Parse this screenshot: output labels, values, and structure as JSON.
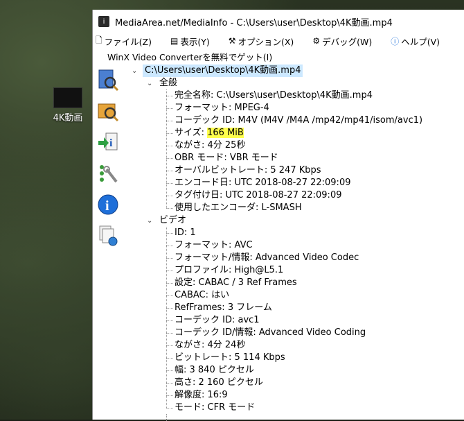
{
  "desktop": {
    "icon_label": "4K動画"
  },
  "window": {
    "title": "MediaArea.net/MediaInfo - C:\\Users\\user\\Desktop\\4K動画.mp4"
  },
  "menu": [
    {
      "label": "ファイル(Z)",
      "icon": "file-icon"
    },
    {
      "label": "表示(Y)",
      "icon": "view-icon"
    },
    {
      "label": "オプション(X)",
      "icon": "options-icon"
    },
    {
      "label": "デバッグ(W)",
      "icon": "debug-icon"
    },
    {
      "label": "ヘルプ(V)",
      "icon": "help-icon"
    }
  ],
  "menu2": {
    "label": "WinX Video Converterを無料でゲット(I)"
  },
  "tree": {
    "root": "C:\\Users\\user\\Desktop\\4K動画.mp4",
    "general": {
      "label": "全般",
      "items": [
        "完全名称: C:\\Users\\user\\Desktop\\4K動画.mp4",
        "フォーマット: MPEG-4",
        "コーデック ID: M4V  (M4V /M4A /mp42/mp41/isom/avc1)"
      ],
      "size_label": "サイズ: ",
      "size_value": "166 MiB",
      "items2": [
        "ながさ: 4分 25秒",
        "OBR モード: VBR モード",
        "オーバルビットレート: 5 247 Kbps",
        "エンコード日: UTC 2018-08-27 22:09:09",
        "タグ付け日: UTC 2018-08-27 22:09:09",
        "使用したエンコーダ: L-SMASH"
      ]
    },
    "video": {
      "label": "ビデオ",
      "items": [
        "ID: 1",
        "フォーマット: AVC",
        "フォーマット/情報: Advanced Video Codec",
        "プロファイル: High@L5.1",
        "設定: CABAC / 3 Ref Frames",
        "CABAC: はい",
        "RefFrames: 3 フレーム",
        "コーデック ID: avc1",
        "コーデック ID/情報: Advanced Video Coding",
        "ながさ: 4分 24秒",
        "ビットレート: 5 114 Kbps",
        "幅: 3 840 ピクセル",
        "高さ: 2 160 ピクセル",
        "解像度: 16:9",
        "モード: CFR モード"
      ]
    }
  }
}
